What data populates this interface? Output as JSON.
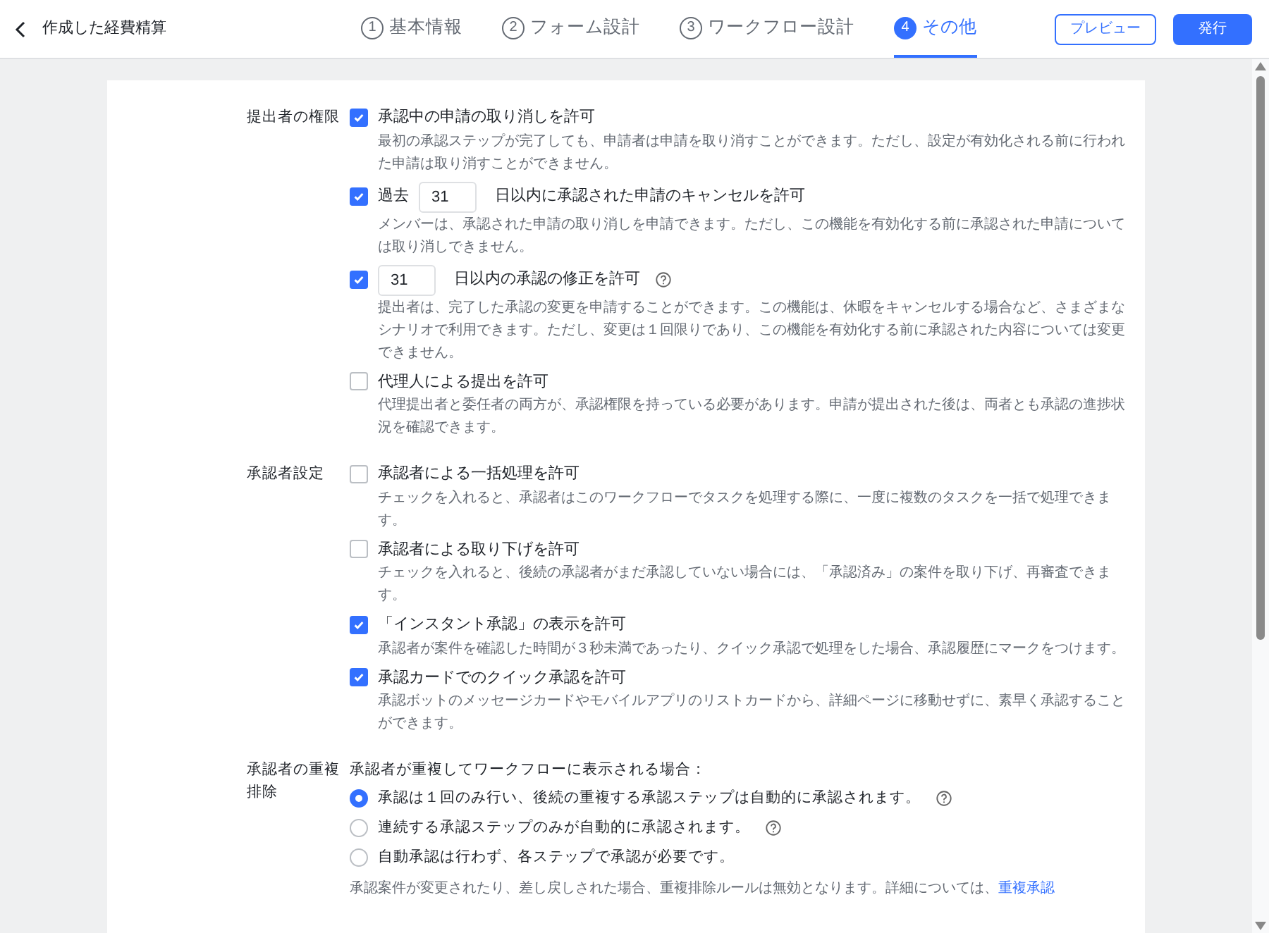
{
  "header": {
    "back_label": "作成した経費精算",
    "steps": [
      {
        "number": "1",
        "label": "基本情報",
        "selected": false
      },
      {
        "number": "2",
        "label": "フォーム設計",
        "selected": false
      },
      {
        "number": "3",
        "label": "ワークフロー設計",
        "selected": false
      },
      {
        "number": "4",
        "label": "その他",
        "selected": true
      }
    ],
    "preview_button": "プレビュー",
    "publish_button": "発行"
  },
  "sections": [
    {
      "label": "提出者の権限",
      "items": [
        {
          "kind": "checkbox",
          "checked": true,
          "label": "承認中の申請の取り消しを許可",
          "description": "最初の承認ステップが完了しても、申請者は申請を取り消すことができます。ただし、設定が有効化される前に行われた申請は取り消すことができません。"
        },
        {
          "kind": "days",
          "checked": true,
          "prefix": "過去",
          "days": "31",
          "label": "日以内に承認された申請のキャンセルを許可",
          "help": false,
          "description": "メンバーは、承認された申請の取り消しを申請できます。ただし、この機能を有効化する前に承認された申請については取り消しできません。"
        },
        {
          "kind": "days",
          "checked": true,
          "days": "31",
          "label": "日以内の承認の修正を許可",
          "help": true,
          "description": "提出者は、完了した承認の変更を申請することができます。この機能は、休暇をキャンセルする場合など、さまざまなシナリオで利用できます。ただし、変更は１回限りであり、この機能を有効化する前に承認された内容については変更できません。"
        },
        {
          "kind": "checkbox",
          "checked": false,
          "label": "代理人による提出を許可",
          "description": "代理提出者と委任者の両方が、承認権限を持っている必要があります。申請が提出された後は、両者とも承認の進捗状況を確認できます。"
        }
      ]
    },
    {
      "label": "承認者設定",
      "items": [
        {
          "kind": "checkbox",
          "checked": false,
          "label": "承認者による一括処理を許可",
          "description": "チェックを入れると、承認者はこのワークフローでタスクを処理する際に、一度に複数のタスクを一括で処理できます。"
        },
        {
          "kind": "checkbox",
          "checked": false,
          "label": "承認者による取り下げを許可",
          "description": "チェックを入れると、後続の承認者がまだ承認していない場合には、「承認済み」の案件を取り下げ、再審査できます。"
        },
        {
          "kind": "checkbox",
          "checked": true,
          "label": "「インスタント承認」の表示を許可",
          "description": "承認者が案件を確認した時間が３秒未満であったり、クイック承認で処理をした場合、承認履歴にマークをつけます。"
        },
        {
          "kind": "checkbox",
          "checked": true,
          "label": "承認カードでのクイック承認を許可",
          "description": "承認ボットのメッセージカードやモバイルアプリのリストカードから、詳細ページに移動せずに、素早く承認することができます。"
        }
      ]
    },
    {
      "label": "承認者の重複排除",
      "intro": "承認者が重複してワークフローに表示される場合：",
      "items": [
        {
          "kind": "radio",
          "selected": true,
          "label": "承認は１回のみ行い、後続の重複する承認ステップは自動的に承認されます。",
          "help": true
        },
        {
          "kind": "radio",
          "selected": false,
          "label": "連続する承認ステップのみが自動的に承認されます。",
          "help": true
        },
        {
          "kind": "radio",
          "selected": false,
          "label": "自動承認は行わず、各ステップで承認が必要です。",
          "help": false
        }
      ],
      "note": "承認案件が変更されたり、差し戻しされた場合、重複排除ルールは無効となります。詳細については、",
      "note_link": "重複承認"
    }
  ]
}
